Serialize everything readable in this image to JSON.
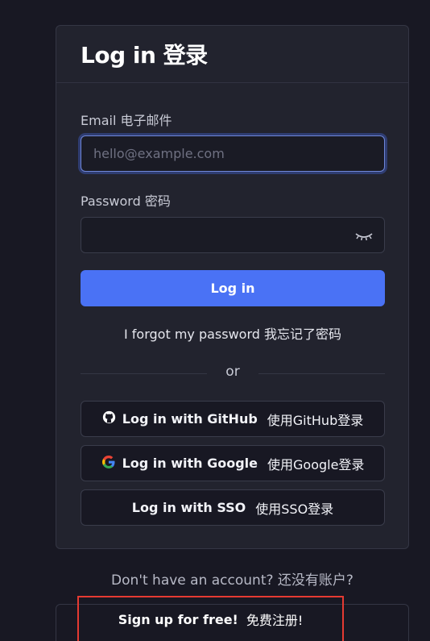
{
  "card": {
    "title": "Log in 登录",
    "email_label": "Email 电子邮件",
    "email_placeholder": "hello@example.com",
    "email_value": "",
    "password_label": "Password 密码",
    "password_value": "",
    "login_button": "Log in",
    "forgot_link": "I forgot my password  我忘记了密码",
    "divider_text": "or",
    "github_button": {
      "en": "Log in with GitHub",
      "cn": "使用GitHub登录",
      "icon": "github-icon"
    },
    "google_button": {
      "en": "Log in with Google",
      "cn": "使用Google登录",
      "icon": "google-icon"
    },
    "sso_button": {
      "en": "Log in with SSO",
      "cn": "使用SSO登录"
    }
  },
  "footer": {
    "no_account": "Don't have an account? 还没有账户?",
    "signup": {
      "en": "Sign up for free!",
      "cn": "免费注册!"
    }
  },
  "colors": {
    "background": "#181823",
    "card": "#22232e",
    "primary": "#4a72f5",
    "highlight": "#e53a32"
  }
}
